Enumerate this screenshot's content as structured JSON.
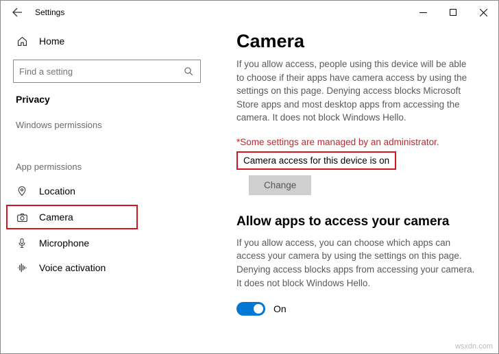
{
  "window": {
    "title": "Settings"
  },
  "sidebar": {
    "home": "Home",
    "search_placeholder": "Find a setting",
    "heading": "Privacy",
    "group1": "Windows permissions",
    "group2": "App permissions",
    "items": {
      "location": "Location",
      "camera": "Camera",
      "microphone": "Microphone",
      "voice_activation": "Voice activation"
    }
  },
  "content": {
    "title": "Camera",
    "desc1": "If you allow access, people using this device will be able to choose if their apps have camera access by using the settings on this page. Denying access blocks Microsoft Store apps and most desktop apps from accessing the camera. It does not block Windows Hello.",
    "admin_note": "*Some settings are managed by an administrator.",
    "status": "Camera access for this device is on",
    "change_btn": "Change",
    "subheading": "Allow apps to access your camera",
    "desc2": "If you allow access, you can choose which apps can access your camera by using the settings on this page. Denying access blocks apps from accessing your camera. It does not block Windows Hello.",
    "toggle_label": "On"
  },
  "watermark": "wsxdn.com"
}
